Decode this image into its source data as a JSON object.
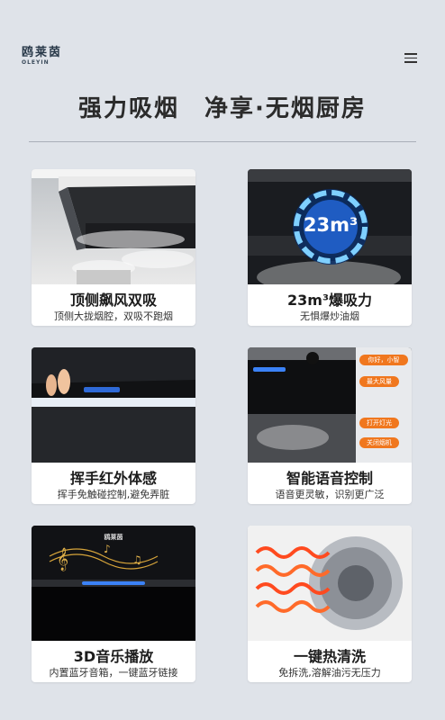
{
  "brand": {
    "logo_text": "鸥莱茵",
    "logo_sub": "OLEYIN"
  },
  "header": {
    "menu_icon": "hamburger-menu-icon"
  },
  "headline": "强力吸烟　净享·无烟厨房",
  "features": [
    {
      "title": "顶侧飙风双吸",
      "subtitle": "顶侧大拢烟腔，双吸不跑烟"
    },
    {
      "title": "23m³爆吸力",
      "subtitle": "无惧爆炒油烟",
      "badge": "23m³"
    },
    {
      "title": "挥手红外体感",
      "subtitle": "挥手免触碰控制,避免弄脏"
    },
    {
      "title": "智能语音控制",
      "subtitle": "语音更灵敏，识别更广泛",
      "voice_commands": [
        "你好，小智",
        "最大风量",
        "打开灯光",
        "关闭烟机"
      ]
    },
    {
      "title": "3D音乐播放",
      "subtitle": "内置蓝牙音箱，一键蓝牙链接",
      "product_logo": "鸥莱茵"
    },
    {
      "title": "一键热清洗",
      "subtitle": "免拆洗,溶解油污无压力"
    }
  ],
  "colors": {
    "background": "#dfe3e9",
    "accent_orange": "#f0771e",
    "accent_blue": "#4aa8ff"
  }
}
